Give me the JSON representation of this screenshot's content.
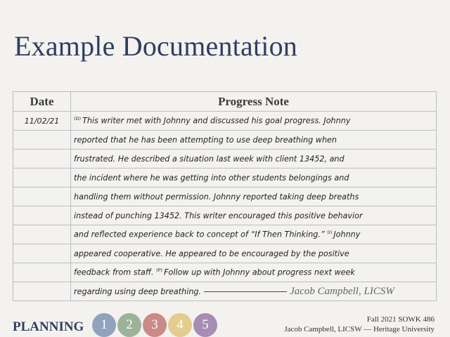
{
  "title": "Example Documentation",
  "table": {
    "header_date": "Date",
    "header_note": "Progress Note",
    "date": "11/02/21",
    "rows": [
      {
        "tag": "(D)",
        "text": "This writer met with Johnny and discussed his goal progress. Johnny"
      },
      {
        "tag": "",
        "text": "reported that he has been attempting to use deep breathing when"
      },
      {
        "tag": "",
        "text": "frustrated. He described a  situation last week with client 13452, and"
      },
      {
        "tag": "",
        "text": "the incident where he was getting into other students belongings and"
      },
      {
        "tag": "",
        "text": "handling them without permission. Johnny reported taking deep breaths"
      },
      {
        "tag": "",
        "text": "instead of punching 13452. This writer encouraged this positive behavior"
      },
      {
        "tag": "",
        "text": "and reflected experience back to concept of “If Then Thinking.”"
      },
      {
        "tag": "",
        "text": "appeared cooperative. He appeared to be encouraged by the positive"
      },
      {
        "tag": "",
        "text": "feedback from staff."
      },
      {
        "tag": "",
        "text": "regarding using deep breathing."
      }
    ],
    "tag_i": "(I)",
    "row7_after_tag": "Johnny",
    "tag_p": "(P)",
    "row9_after_tag": "Follow up with Johnny about progress next week",
    "signature": "Jacob Campbell, LICSW"
  },
  "footer": {
    "planning_label": "PLANNING",
    "steps": [
      {
        "label": "1",
        "color": "#8fa3bd"
      },
      {
        "label": "2",
        "color": "#9cb39a"
      },
      {
        "label": "3",
        "color": "#c98a88"
      },
      {
        "label": "4",
        "color": "#e2cd8e"
      },
      {
        "label": "5",
        "color": "#a78db3"
      }
    ],
    "course": "Fall 2021 SOWK 486",
    "author": "Jacob Campbell, LICSW — Heritage University"
  }
}
